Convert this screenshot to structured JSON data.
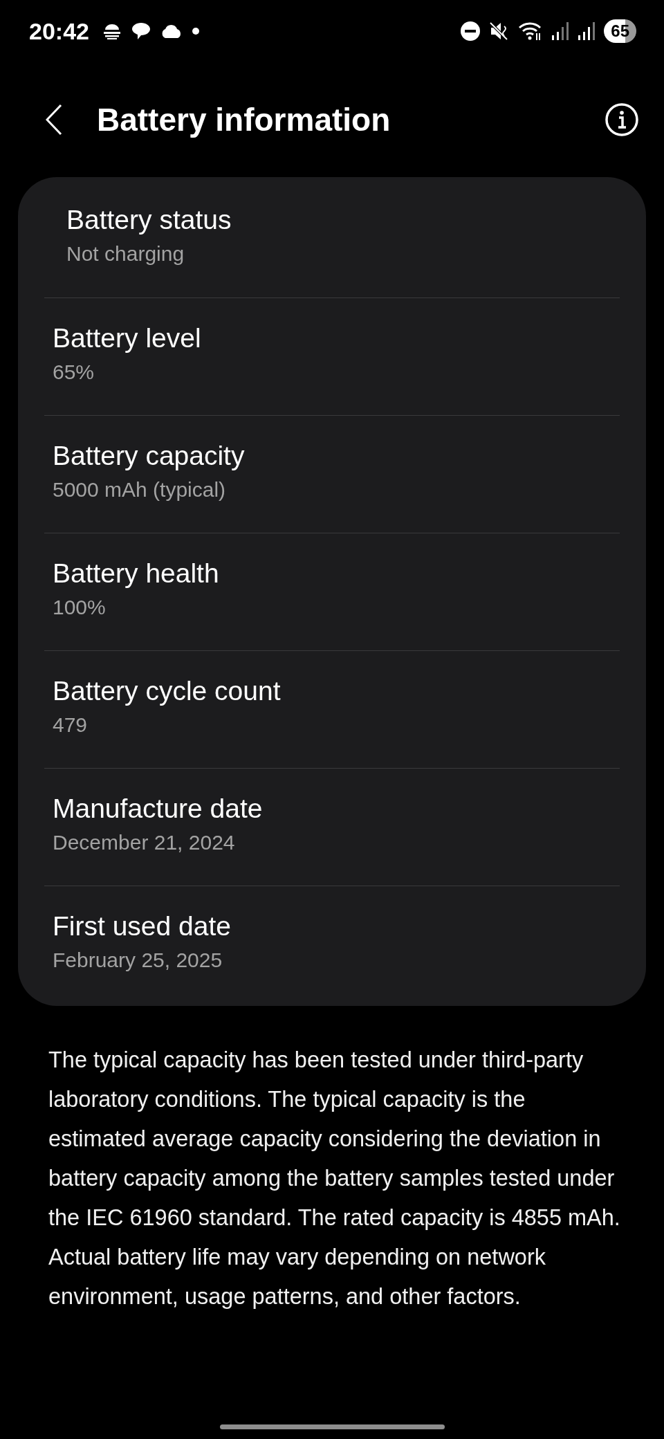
{
  "status_bar": {
    "time": "20:42",
    "battery": "65"
  },
  "header": {
    "title": "Battery information"
  },
  "items": [
    {
      "title": "Battery status",
      "value": "Not charging"
    },
    {
      "title": "Battery level",
      "value": "65%"
    },
    {
      "title": "Battery capacity",
      "value": "5000 mAh (typical)"
    },
    {
      "title": "Battery health",
      "value": "100%"
    },
    {
      "title": "Battery cycle count",
      "value": "479"
    },
    {
      "title": "Manufacture date",
      "value": "December 21, 2024"
    },
    {
      "title": "First used date",
      "value": "February 25, 2025"
    }
  ],
  "note": "The typical capacity has been tested under third-party laboratory conditions. The typical capacity is the estimated average capacity considering the deviation in battery capacity among the battery samples tested under the IEC 61960 standard. The rated capacity is 4855 mAh. Actual battery life may vary depending on network environment, usage patterns, and other factors."
}
